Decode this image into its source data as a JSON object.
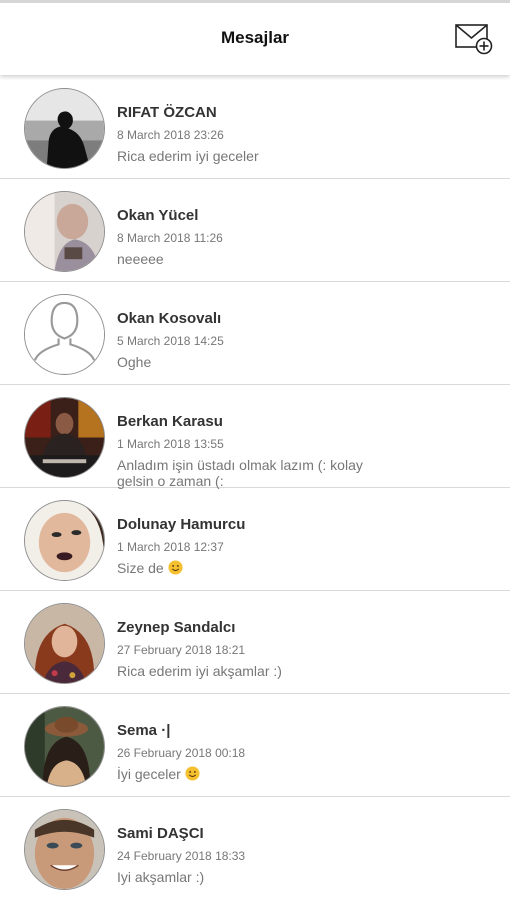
{
  "header": {
    "title": "Mesajlar",
    "new_message_icon": "envelope-plus-icon"
  },
  "conversations": [
    {
      "name": "RIFAT ÖZCAN",
      "date": "8 March 2018 23:26",
      "message": "Rica ederim iyi geceler",
      "emoji": ""
    },
    {
      "name": "Okan Yücel",
      "date": "8 March 2018 11:26",
      "message": "neeeee",
      "emoji": ""
    },
    {
      "name": "Okan Kosovalı",
      "date": "5 March 2018 14:25",
      "message": "Oghe",
      "emoji": ""
    },
    {
      "name": "Berkan Karasu",
      "date": "1 March 2018 13:55",
      "message": "Anladım işin üstadı olmak lazım (: kolay gelsin o zaman (:",
      "emoji": ""
    },
    {
      "name": "Dolunay Hamurcu",
      "date": "1 March 2018 12:37",
      "message": "Size de ",
      "emoji": "smiling-face-emoji"
    },
    {
      "name": "Zeynep Sandalcı",
      "date": "27 February 2018 18:21",
      "message": "Rica ederim iyi akşamlar :)",
      "emoji": ""
    },
    {
      "name": "Sema ·|",
      "date": "26 February 2018 00:18",
      "message": "İyi geceler ",
      "emoji": "smiling-face-emoji"
    },
    {
      "name": "Sami DAŞCI",
      "date": "24 February 2018 18:33",
      "message": "Iyi akşamlar :)",
      "emoji": ""
    }
  ]
}
